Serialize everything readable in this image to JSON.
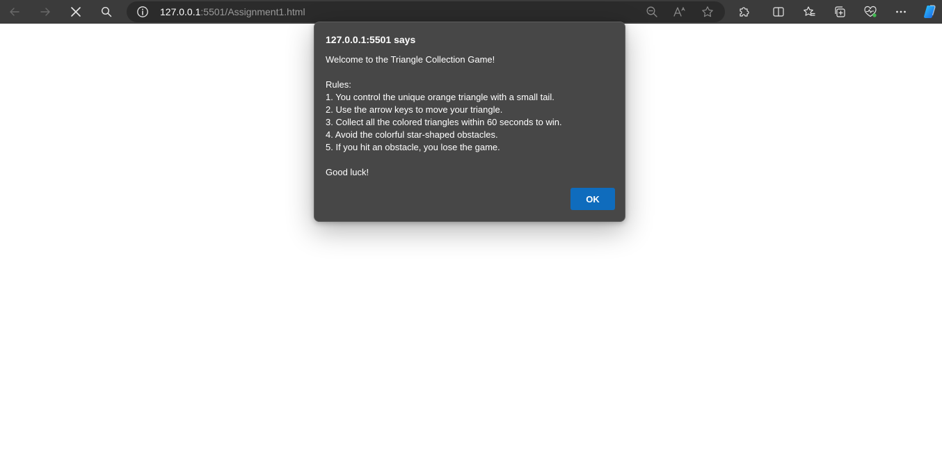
{
  "browser": {
    "address_bar": {
      "url_host": "127.0.0.1",
      "url_rest": ":5501/Assignment1.html"
    },
    "icons": {
      "back": "arrow-left-icon",
      "forward": "arrow-right-icon",
      "stop": "close-icon",
      "search": "search-icon",
      "site_info": "info-icon",
      "zoom": "zoom-out-icon",
      "read_aloud": "read-aloud-icon",
      "favorite": "star-icon",
      "extensions": "puzzle-icon",
      "split_screen": "split-screen-icon",
      "favorites": "favorites-icon",
      "collections": "collections-icon",
      "performance": "heart-pulse-icon",
      "more": "more-icon",
      "copilot": "copilot-icon"
    }
  },
  "dialog": {
    "title": "127.0.0.1:5501 says",
    "message_lines": [
      "Welcome to the Triangle Collection Game!",
      "",
      "Rules:",
      "1. You control the unique orange triangle with a small tail.",
      "2. Use the arrow keys to move your triangle.",
      "3. Collect all the colored triangles within 60 seconds to win.",
      "4. Avoid the colorful star-shaped obstacles.",
      "5. If you hit an obstacle, you lose the game.",
      "",
      "Good luck!"
    ],
    "ok_label": "OK"
  },
  "colors": {
    "toolbar_bg": "#3b3b3b",
    "addressbar_bg": "#2b2b2b",
    "dialog_bg": "#474747",
    "button_accent": "#0f6cbd"
  }
}
